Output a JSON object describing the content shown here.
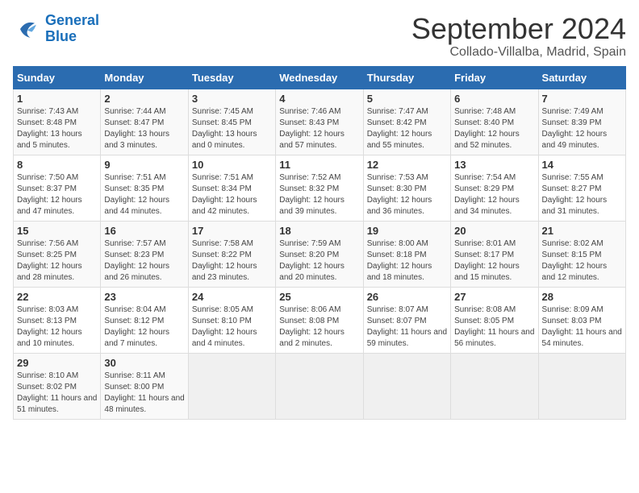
{
  "logo": {
    "line1": "General",
    "line2": "Blue"
  },
  "title": "September 2024",
  "location": "Collado-Villalba, Madrid, Spain",
  "headers": [
    "Sunday",
    "Monday",
    "Tuesday",
    "Wednesday",
    "Thursday",
    "Friday",
    "Saturday"
  ],
  "weeks": [
    [
      {
        "day": "1",
        "sunrise": "7:43 AM",
        "sunset": "8:48 PM",
        "daylight": "13 hours and 5 minutes."
      },
      {
        "day": "2",
        "sunrise": "7:44 AM",
        "sunset": "8:47 PM",
        "daylight": "13 hours and 3 minutes."
      },
      {
        "day": "3",
        "sunrise": "7:45 AM",
        "sunset": "8:45 PM",
        "daylight": "13 hours and 0 minutes."
      },
      {
        "day": "4",
        "sunrise": "7:46 AM",
        "sunset": "8:43 PM",
        "daylight": "12 hours and 57 minutes."
      },
      {
        "day": "5",
        "sunrise": "7:47 AM",
        "sunset": "8:42 PM",
        "daylight": "12 hours and 55 minutes."
      },
      {
        "day": "6",
        "sunrise": "7:48 AM",
        "sunset": "8:40 PM",
        "daylight": "12 hours and 52 minutes."
      },
      {
        "day": "7",
        "sunrise": "7:49 AM",
        "sunset": "8:39 PM",
        "daylight": "12 hours and 49 minutes."
      }
    ],
    [
      {
        "day": "8",
        "sunrise": "7:50 AM",
        "sunset": "8:37 PM",
        "daylight": "12 hours and 47 minutes."
      },
      {
        "day": "9",
        "sunrise": "7:51 AM",
        "sunset": "8:35 PM",
        "daylight": "12 hours and 44 minutes."
      },
      {
        "day": "10",
        "sunrise": "7:51 AM",
        "sunset": "8:34 PM",
        "daylight": "12 hours and 42 minutes."
      },
      {
        "day": "11",
        "sunrise": "7:52 AM",
        "sunset": "8:32 PM",
        "daylight": "12 hours and 39 minutes."
      },
      {
        "day": "12",
        "sunrise": "7:53 AM",
        "sunset": "8:30 PM",
        "daylight": "12 hours and 36 minutes."
      },
      {
        "day": "13",
        "sunrise": "7:54 AM",
        "sunset": "8:29 PM",
        "daylight": "12 hours and 34 minutes."
      },
      {
        "day": "14",
        "sunrise": "7:55 AM",
        "sunset": "8:27 PM",
        "daylight": "12 hours and 31 minutes."
      }
    ],
    [
      {
        "day": "15",
        "sunrise": "7:56 AM",
        "sunset": "8:25 PM",
        "daylight": "12 hours and 28 minutes."
      },
      {
        "day": "16",
        "sunrise": "7:57 AM",
        "sunset": "8:23 PM",
        "daylight": "12 hours and 26 minutes."
      },
      {
        "day": "17",
        "sunrise": "7:58 AM",
        "sunset": "8:22 PM",
        "daylight": "12 hours and 23 minutes."
      },
      {
        "day": "18",
        "sunrise": "7:59 AM",
        "sunset": "8:20 PM",
        "daylight": "12 hours and 20 minutes."
      },
      {
        "day": "19",
        "sunrise": "8:00 AM",
        "sunset": "8:18 PM",
        "daylight": "12 hours and 18 minutes."
      },
      {
        "day": "20",
        "sunrise": "8:01 AM",
        "sunset": "8:17 PM",
        "daylight": "12 hours and 15 minutes."
      },
      {
        "day": "21",
        "sunrise": "8:02 AM",
        "sunset": "8:15 PM",
        "daylight": "12 hours and 12 minutes."
      }
    ],
    [
      {
        "day": "22",
        "sunrise": "8:03 AM",
        "sunset": "8:13 PM",
        "daylight": "12 hours and 10 minutes."
      },
      {
        "day": "23",
        "sunrise": "8:04 AM",
        "sunset": "8:12 PM",
        "daylight": "12 hours and 7 minutes."
      },
      {
        "day": "24",
        "sunrise": "8:05 AM",
        "sunset": "8:10 PM",
        "daylight": "12 hours and 4 minutes."
      },
      {
        "day": "25",
        "sunrise": "8:06 AM",
        "sunset": "8:08 PM",
        "daylight": "12 hours and 2 minutes."
      },
      {
        "day": "26",
        "sunrise": "8:07 AM",
        "sunset": "8:07 PM",
        "daylight": "11 hours and 59 minutes."
      },
      {
        "day": "27",
        "sunrise": "8:08 AM",
        "sunset": "8:05 PM",
        "daylight": "11 hours and 56 minutes."
      },
      {
        "day": "28",
        "sunrise": "8:09 AM",
        "sunset": "8:03 PM",
        "daylight": "11 hours and 54 minutes."
      }
    ],
    [
      {
        "day": "29",
        "sunrise": "8:10 AM",
        "sunset": "8:02 PM",
        "daylight": "11 hours and 51 minutes."
      },
      {
        "day": "30",
        "sunrise": "8:11 AM",
        "sunset": "8:00 PM",
        "daylight": "11 hours and 48 minutes."
      },
      null,
      null,
      null,
      null,
      null
    ]
  ]
}
